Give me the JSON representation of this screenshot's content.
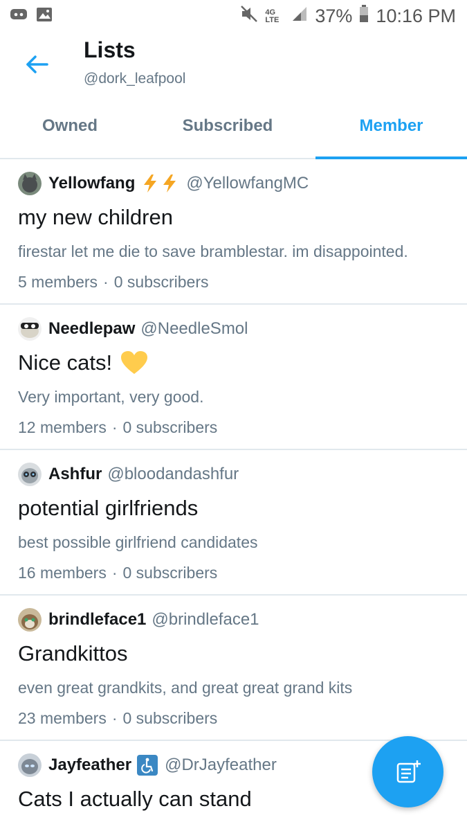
{
  "statusbar": {
    "left_icons": [
      "discord-icon",
      "image-icon"
    ],
    "network": "4G LTE",
    "battery": "37%",
    "time": "10:16 PM"
  },
  "header": {
    "back_icon": "arrow-left-icon",
    "title": "Lists",
    "subtitle": "@dork_leafpool"
  },
  "tabs": [
    {
      "label": "Owned",
      "active": false
    },
    {
      "label": "Subscribed",
      "active": false
    },
    {
      "label": "Member",
      "active": true
    }
  ],
  "lists": [
    {
      "owner_name": "Yellowfang",
      "owner_extra": "⚡⚡",
      "owner_handle": "@YellowfangMC",
      "name": "my new children",
      "description": "firestar let me die to save bramblestar. im disappointed.",
      "members": "5 members",
      "subscribers": "0 subscribers"
    },
    {
      "owner_name": "Needlepaw",
      "owner_extra": "",
      "owner_handle": "@NeedleSmol",
      "name": "Nice cats!",
      "name_emoji": "yellow-heart-icon",
      "description": "Very important, very good.",
      "members": "12 members",
      "subscribers": "0 subscribers"
    },
    {
      "owner_name": "Ashfur",
      "owner_extra": "",
      "owner_handle": "@bloodandashfur",
      "name": "potential girlfriends",
      "description": "best possible girlfriend candidates",
      "members": "16 members",
      "subscribers": "0 subscribers"
    },
    {
      "owner_name": "brindleface1",
      "owner_extra": "",
      "owner_handle": "@brindleface1",
      "name": "Grandkittos",
      "description": "even great grandkits, and great great grand kits",
      "members": "23 members",
      "subscribers": "0 subscribers"
    },
    {
      "owner_name": "Jayfeather",
      "owner_extra": "♿",
      "owner_handle": "@DrJayfeather",
      "name": "Cats I actually can stand"
    }
  ],
  "separator": "·",
  "fab_icon": "new-list-icon",
  "colors": {
    "accent": "#1da1f2",
    "muted": "#657786",
    "text": "#14171a"
  }
}
